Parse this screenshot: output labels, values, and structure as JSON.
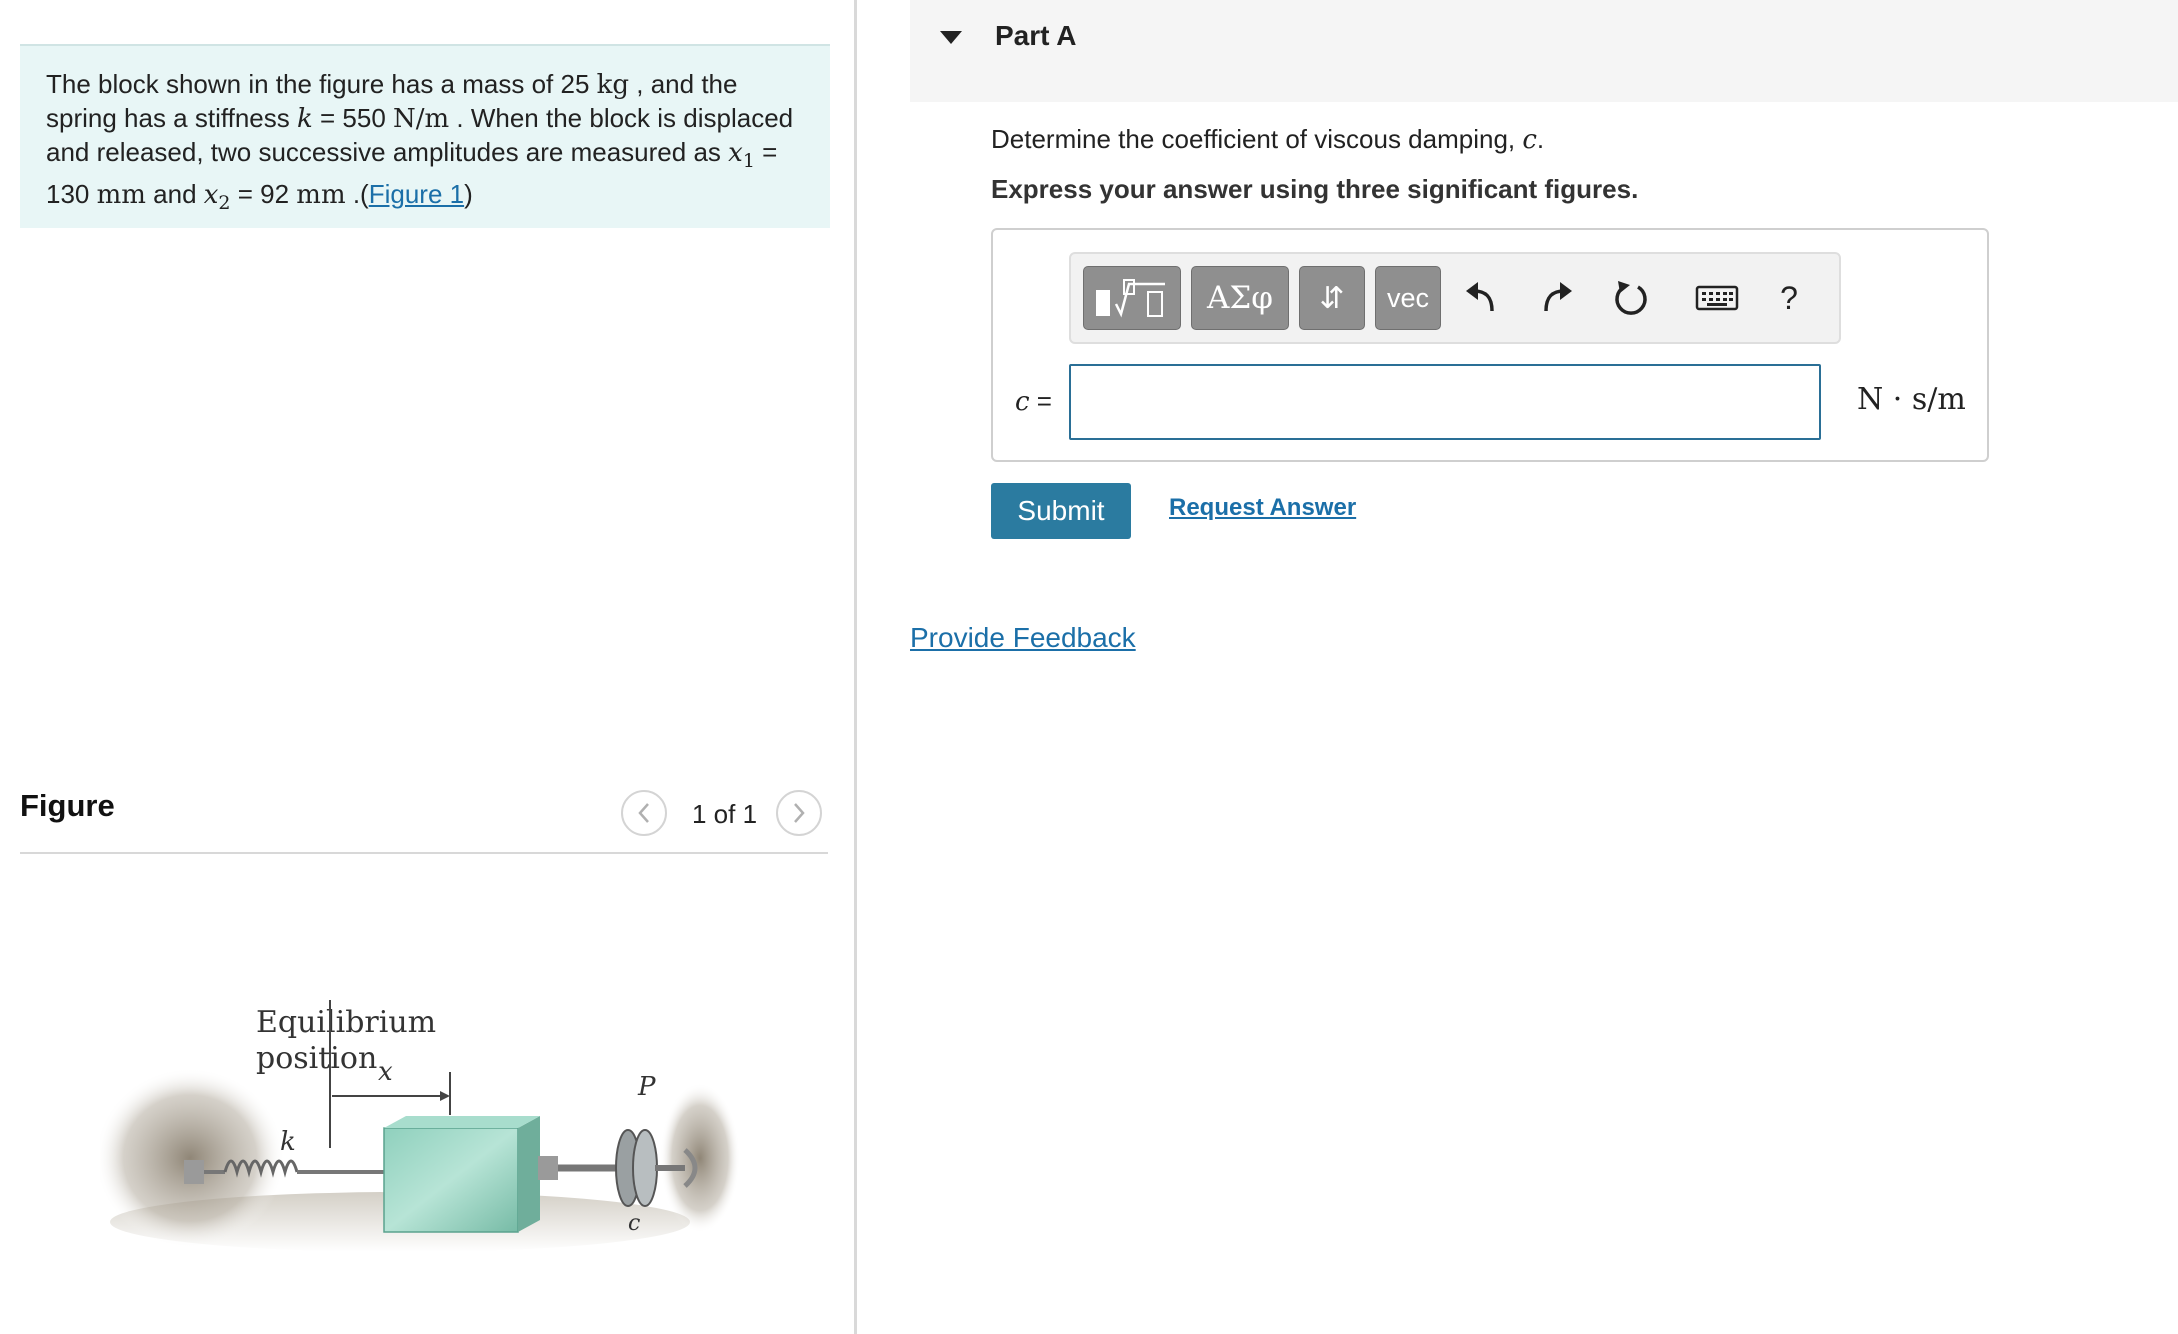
{
  "problem": {
    "t1": "The block shown in the figure has a mass of 25 ",
    "u_mass": "kg",
    "t2": " , and the spring has a stiffness ",
    "k_sym": "k",
    "t3": " = 550 ",
    "u_stiff": "N/m",
    "t4": " . When the block is displaced and released, two successive amplitudes are measured as ",
    "x1_sym": "x",
    "x1_sub": "1",
    "t5": " = 130 ",
    "u_mm1": "mm",
    "t6": " and ",
    "x2_sym": "x",
    "x2_sub": "2",
    "t7": " = 92 ",
    "u_mm2": "mm",
    "t8": " .(",
    "figure_link": "Figure 1",
    "t9": ")"
  },
  "figure": {
    "title": "Figure",
    "pager": "1 of 1",
    "labels": {
      "equilibrium": "Equilibrium",
      "position": "position",
      "x": "x",
      "k": "k",
      "p": "P",
      "c": "c"
    }
  },
  "part": {
    "title": "Part A",
    "question_text": "Determine the coefficient of viscous damping, ",
    "question_var": "c",
    "question_end": ".",
    "instruction": "Express your answer using three significant figures."
  },
  "toolbar": {
    "greek_label": "ΑΣφ",
    "arrows_label": "⇵",
    "vec_label": "vec",
    "help_label": "?"
  },
  "answer": {
    "var_label": "c",
    "eq_label": " =",
    "value": "",
    "units": "N · s/m"
  },
  "actions": {
    "submit_label": "Submit",
    "request_answer_label": "Request Answer",
    "feedback_label": "Provide Feedback"
  }
}
